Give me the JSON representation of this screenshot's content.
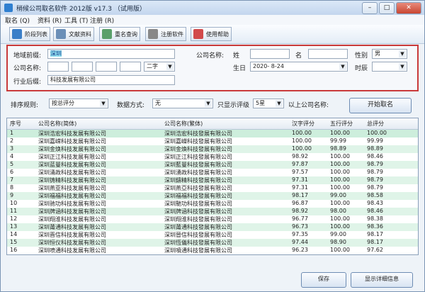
{
  "window": {
    "title": "稍候公司取名软件 2012版 v17.3 （试用版）"
  },
  "menu": {
    "items": [
      "取名 (Q)",
      "资料 (R)",
      "工具 (T)",
      "注册 (R)"
    ]
  },
  "toolbar": {
    "items": [
      "阶段列表",
      "文献资料",
      "重名查询",
      "注册软件",
      "使用帮助"
    ]
  },
  "filters": {
    "area_label": "地域前缀:",
    "area_value": "深圳",
    "company_name_label": "公司名称:",
    "char_count_value": "二字",
    "industry_label": "行业后缀:",
    "industry_value": "科技发展有限公司",
    "owner_name_label": "公司名称:",
    "surname_label": "姓",
    "given_label": "名",
    "gender_label": "性别",
    "gender_value": "男",
    "birthday_label": "生日",
    "birthday_value": "2020- 8-24",
    "time_label": "时辰"
  },
  "options": {
    "sort_label": "排序规则:",
    "sort_value": "按总评分",
    "sort_type_label": "数据方式:",
    "sort_type_value": "无",
    "show_label": "只显示评级",
    "show_value": "5星",
    "above_label": "以上公司名称:",
    "start_button": "开始取名"
  },
  "table": {
    "headers": [
      "序号",
      "公司名称(简体)",
      "公司名称(繁体)",
      "汉字评分",
      "五行评分",
      "总评分"
    ],
    "rows": [
      [
        "1",
        "深圳浩宏科技发展有限公司",
        "深圳浩宏科技發展有限公司",
        "100.00",
        "100.00",
        "100.00"
      ],
      [
        "2",
        "深圳嘉嵘科技发展有限公司",
        "深圳嘉嶸科技發展有限公司",
        "100.00",
        "99.99",
        "99.99"
      ],
      [
        "3",
        "深圳金焕科技发展有限公司",
        "深圳金煥科技發展有限公司",
        "100.00",
        "98.89",
        "98.89"
      ],
      [
        "4",
        "深圳正江科技发展有限公司",
        "深圳正江科技發展有限公司",
        "98.92",
        "100.00",
        "98.46"
      ],
      [
        "5",
        "深圳蓝曼科技发展有限公司",
        "深圳藍曼科技發展有限公司",
        "97.87",
        "100.00",
        "98.79"
      ],
      [
        "6",
        "深圳涌政科技发展有限公司",
        "深圳湧政科技發展有限公司",
        "97.57",
        "100.00",
        "98.79"
      ],
      [
        "7",
        "深圳铸精科技发展有限公司",
        "深圳鑄精科技發展有限公司",
        "97.31",
        "100.00",
        "98.79"
      ],
      [
        "8",
        "深圳燕亚科技发展有限公司",
        "深圳燕亞科技發展有限公司",
        "97.31",
        "100.00",
        "98.79"
      ],
      [
        "9",
        "深圳福福科技发展有限公司",
        "深圳福福科技發展有限公司",
        "98.17",
        "99.00",
        "98.58"
      ],
      [
        "10",
        "深圳驰功科技发展有限公司",
        "深圳馳功科技發展有限公司",
        "96.87",
        "100.00",
        "98.43"
      ],
      [
        "11",
        "深圳牌涵科技发展有限公司",
        "深圳牌涵科技發展有限公司",
        "98.92",
        "98.00",
        "98.46"
      ],
      [
        "12",
        "深圳翔淮科技发展有限公司",
        "深圳翔淮科技發展有限公司",
        "96.77",
        "100.00",
        "98.38"
      ],
      [
        "13",
        "深圳莆通科技发展有限公司",
        "深圳莆通科技發展有限公司",
        "96.73",
        "100.00",
        "98.36"
      ],
      [
        "14",
        "深圳晋信科技发展有限公司",
        "深圳晉信科技發展有限公司",
        "97.35",
        "99.00",
        "98.17"
      ],
      [
        "15",
        "深圳恒仪科技发展有限公司",
        "深圳恆儀科技發展有限公司",
        "97.44",
        "98.90",
        "98.17"
      ],
      [
        "16",
        "深圳喷通科技发展有限公司",
        "深圳噴通科技發展有限公司",
        "96.23",
        "100.00",
        "97.62"
      ]
    ]
  },
  "bottom": {
    "btn1": "保存",
    "btn2": "显示详细信息"
  }
}
